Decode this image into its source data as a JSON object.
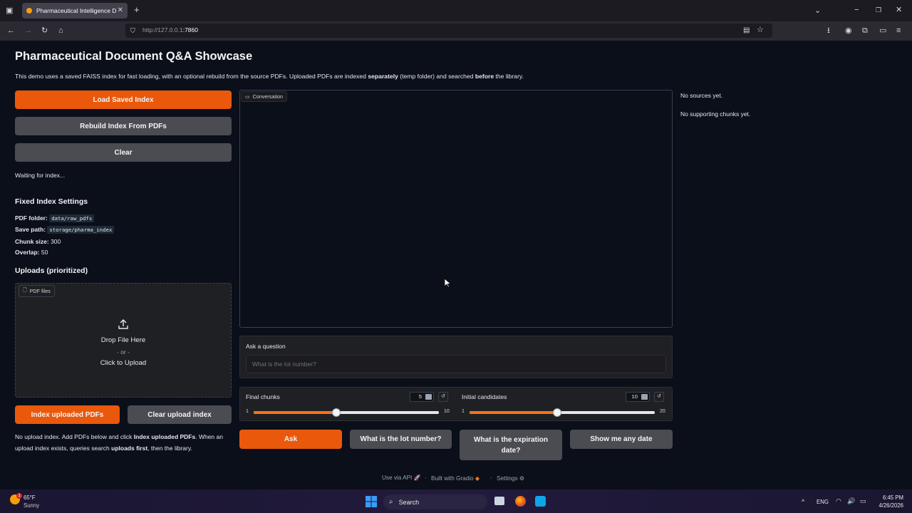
{
  "browser": {
    "tab_title": "Pharmaceutical Intelligence Do",
    "url_host": "http://127.0.0.1",
    "url_port": ":7860"
  },
  "app": {
    "title": "Pharmaceutical Document Q&A Showcase",
    "desc_part1": "This demo uses a saved FAISS index for fast loading, with an optional rebuild from the source PDFs. Uploaded PDFs are indexed ",
    "desc_bold1": "separately",
    "desc_part2": " (temp folder) and searched ",
    "desc_bold2": "before",
    "desc_part3": " the library.",
    "load_button": "Load Saved Index",
    "rebuild_button": "Rebuild Index From PDFs",
    "clear_button": "Clear",
    "status": "Waiting for index...",
    "fixed_heading": "Fixed Index Settings",
    "settings": {
      "pdf_folder_label": "PDF folder:",
      "pdf_folder_value": "data/raw_pdfs",
      "save_path_label": "Save path:",
      "save_path_value": "storage/pharma_index",
      "chunk_size_label": "Chunk size:",
      "chunk_size_value": "300",
      "overlap_label": "Overlap:",
      "overlap_value": "50"
    },
    "uploads_heading": "Uploads (prioritized)",
    "upload": {
      "chip_label": "PDF files",
      "drop": "Drop File Here",
      "or": "- or -",
      "click": "Click to Upload"
    },
    "index_uploaded_button": "Index uploaded PDFs",
    "clear_upload_button": "Clear upload index",
    "note_part1": "No upload index. Add PDFs below and click ",
    "note_bold1": "Index uploaded PDFs",
    "note_part2": ". When an",
    "note_part3": "upload index exists, queries search ",
    "note_bold2": "uploads first",
    "note_part4": ", then the library.",
    "conversation_label": "Conversation",
    "question_label": "Ask a question",
    "question_placeholder": "What is the lot number?",
    "final_chunks": {
      "label": "Final chunks",
      "value": "5",
      "min": "1",
      "max": "10",
      "value_num": 5,
      "min_num": 1,
      "max_num": 10
    },
    "initial_candidates": {
      "label": "Initial candidates",
      "value": "10",
      "min": "1",
      "max": "20",
      "value_num": 10,
      "min_num": 1,
      "max_num": 20
    },
    "ask_button": "Ask",
    "example1": "What is the lot number?",
    "example2_line1": "What is the expiration",
    "example2_line2": "date?",
    "example3": "Show me any date",
    "sources": "No sources yet.",
    "chunks": "No supporting chunks yet.",
    "footer_api": "Use via API",
    "footer_gradio": "Built with Gradio",
    "footer_settings": "Settings"
  },
  "taskbar": {
    "temp": "65°F",
    "weather": "Sunny",
    "search": "Search",
    "lang": "ENG",
    "time": "6:45 PM",
    "date": "4/26/2026",
    "weather_badge": "1"
  },
  "colors": {
    "primary": "#ea580c",
    "secondary": "#4b4b52",
    "background": "#0b0f19"
  }
}
